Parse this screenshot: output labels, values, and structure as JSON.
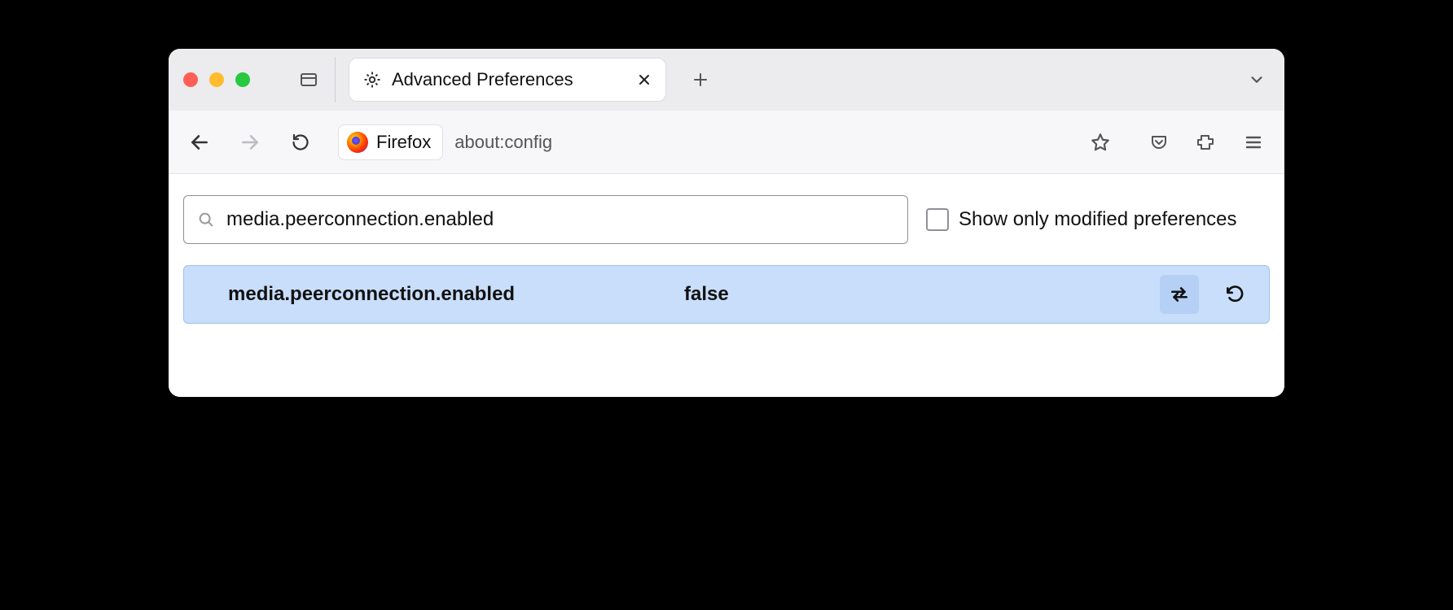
{
  "window": {
    "tab": {
      "title": "Advanced Preferences"
    }
  },
  "urlbar": {
    "identity_label": "Firefox",
    "url": "about:config"
  },
  "config": {
    "search_value": "media.peerconnection.enabled",
    "filter_checkbox_label": "Show only modified preferences",
    "filter_checked": false,
    "result": {
      "name": "media.peerconnection.enabled",
      "value": "false"
    }
  }
}
